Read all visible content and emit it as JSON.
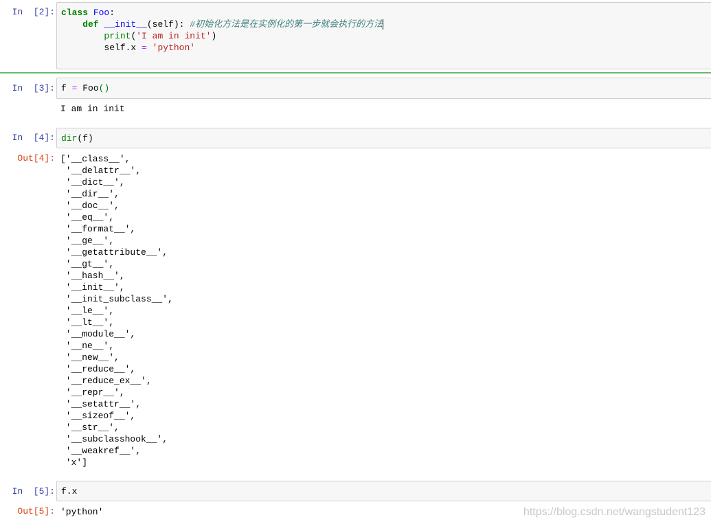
{
  "cells": {
    "c2": {
      "prompt": "In  [2]:",
      "line1": {
        "kw": "class",
        "sp": " ",
        "name": "Foo",
        "colon": ":"
      },
      "line2": {
        "indent": "    ",
        "kw": "def",
        "sp": " ",
        "name": "__init__",
        "args": "(self):",
        "sp2": " ",
        "comment": "#初始化方法是在实例化的第一步就会执行的方法"
      },
      "line3": {
        "indent": "        ",
        "fn": "print",
        "open": "(",
        "str": "'I am in init'",
        "close": ")"
      },
      "line4": {
        "indent": "        ",
        "attr": "self.x",
        "sp": " ",
        "op": "=",
        "sp2": " ",
        "str": "'python'"
      }
    },
    "c3": {
      "prompt": "In  [3]:",
      "code": {
        "var": "f",
        "sp": " ",
        "op": "=",
        "sp2": " ",
        "name": "Foo",
        "call": "()"
      },
      "stdout": "I am in init"
    },
    "c4": {
      "prompt": "In  [4]:",
      "code": {
        "fn": "dir",
        "args": "(f)"
      },
      "out_prompt": "Out[4]:",
      "output": [
        "['__class__',",
        " '__delattr__',",
        " '__dict__',",
        " '__dir__',",
        " '__doc__',",
        " '__eq__',",
        " '__format__',",
        " '__ge__',",
        " '__getattribute__',",
        " '__gt__',",
        " '__hash__',",
        " '__init__',",
        " '__init_subclass__',",
        " '__le__',",
        " '__lt__',",
        " '__module__',",
        " '__ne__',",
        " '__new__',",
        " '__reduce__',",
        " '__reduce_ex__',",
        " '__repr__',",
        " '__setattr__',",
        " '__sizeof__',",
        " '__str__',",
        " '__subclasshook__',",
        " '__weakref__',",
        " 'x']"
      ]
    },
    "c5": {
      "prompt": "In  [5]:",
      "code": "f.x",
      "out_prompt": "Out[5]:",
      "output": "'python'"
    }
  },
  "watermark": "https://blog.csdn.net/wangstudent123",
  "colors": {
    "in_prompt": "#303f9f",
    "out_prompt": "#d84315",
    "keyword": "#008000",
    "string": "#ba2121",
    "comment": "#408080",
    "selected_border": "#66bb6a"
  }
}
